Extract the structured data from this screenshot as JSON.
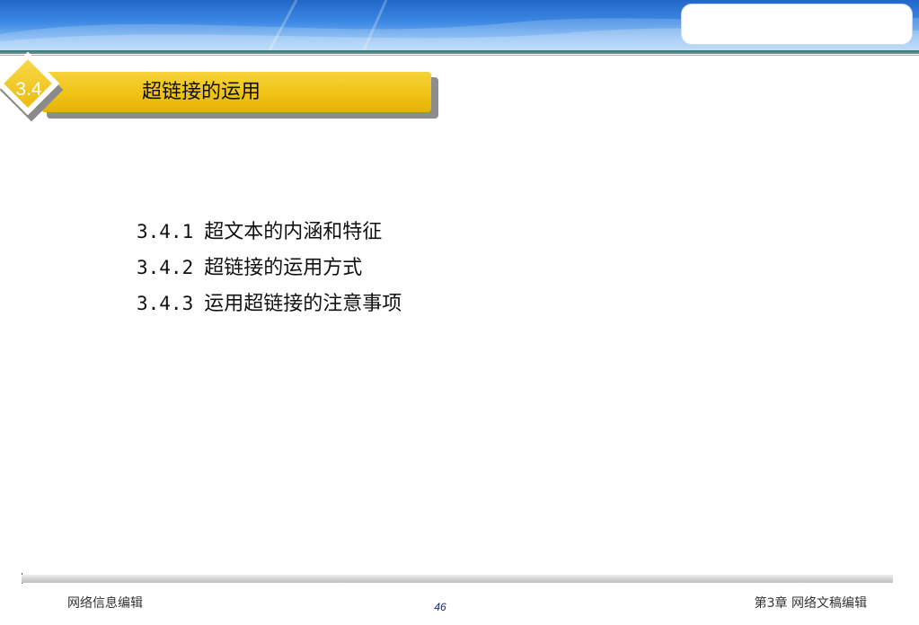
{
  "slide": {
    "section_number": "3.4",
    "title": "超链接的运用",
    "subsections": [
      {
        "number": "3.4.1",
        "title": "超文本的内涵和特征"
      },
      {
        "number": "3.4.2",
        "title": "超链接的运用方式"
      },
      {
        "number": "3.4.3",
        "title": "运用超链接的注意事项"
      }
    ]
  },
  "footer": {
    "left": "网络信息编辑",
    "page": "46",
    "right": "第3章  网络文稿编辑"
  },
  "colors": {
    "banner_blue": "#3f8ae4",
    "title_yellow": "#f0c314",
    "rule_teal": "#2e7a72",
    "page_number_blue": "#1a2a8a"
  }
}
